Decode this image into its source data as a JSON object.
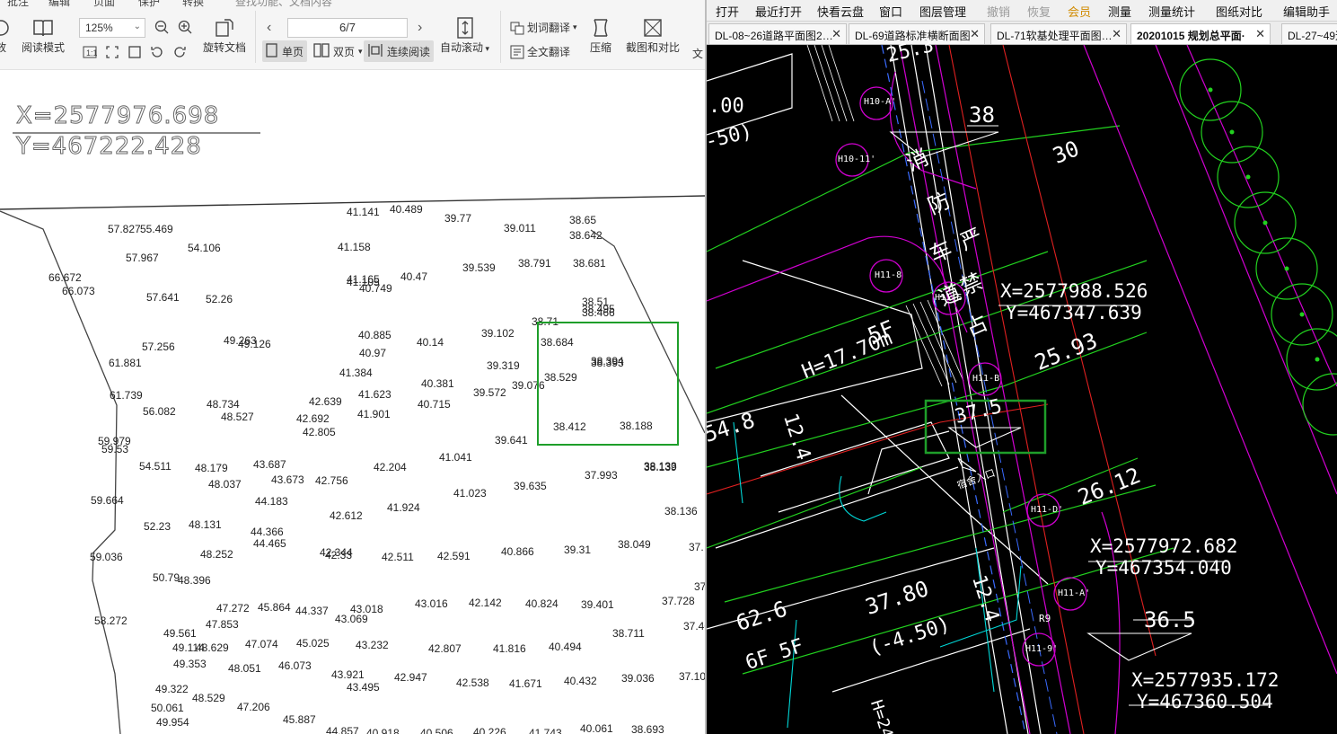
{
  "left_viewer": {
    "menu_fragments": [
      "批注",
      "编辑",
      "页面",
      "保护",
      "转换"
    ],
    "search_placeholder": "查找功能、文档内容",
    "buttons": {
      "zoom_partial": "放",
      "reading_mode": "阅读模式",
      "rotate_doc": "旋转文档",
      "auto_scroll": "自动滚动",
      "compress": "压缩",
      "screenshot_compare": "截图和对比",
      "text_partial": "文"
    },
    "zoom_value": "125%",
    "page_indicator": "6/7",
    "view_modes": {
      "single": "单页",
      "double": "双页",
      "continuous": "连续阅读"
    },
    "translate": {
      "word": "划词翻译",
      "full": "全文翻译"
    },
    "doc": {
      "coord_x": "X=2577976.698",
      "coord_y": "Y=467222.428",
      "elevations": [
        "41.141",
        "40.489",
        "39.77",
        "39.011",
        "38.65",
        "38.642",
        "57.827",
        "55.469",
        "54.106",
        "57.967",
        "41.158",
        "39.539",
        "38.791",
        "38.681",
        "66.672",
        "66.073",
        "41.165",
        "41.105",
        "40.749",
        "40.47",
        "57.641",
        "52.26",
        "38.51",
        "38.495",
        "38.466",
        "38.71",
        "57.256",
        "49.263",
        "49.126",
        "40.885",
        "40.14",
        "39.102",
        "38.684",
        "61.881",
        "40.97",
        "38.394",
        "38.393",
        "39.319",
        "41.384",
        "38.529",
        "40.381",
        "39.076",
        "39.572",
        "61.739",
        "48.734",
        "42.639",
        "41.623",
        "40.715",
        "56.082",
        "48.527",
        "42.692",
        "41.901",
        "42.805",
        "38.412",
        "38.188",
        "39.641",
        "59.979",
        "59.53",
        "41.041",
        "38.139",
        "38.133",
        "54.511",
        "48.179",
        "43.687",
        "43.673",
        "42.756",
        "42.204",
        "37.993",
        "48.037",
        "41.023",
        "39.635",
        "59.664",
        "44.183",
        "41.924",
        "38.136",
        "52.23",
        "48.131",
        "42.612",
        "44.366",
        "44.465",
        "38.049",
        "59.036",
        "48.252",
        "42.344",
        "42.33",
        "42.511",
        "42.591",
        "40.866",
        "39.31",
        "37.",
        "50.79",
        "48.396",
        "37",
        "47.272",
        "45.864",
        "44.337",
        "43.018",
        "43.016",
        "42.142",
        "40.824",
        "39.401",
        "37.728",
        "58.272",
        "47.853",
        "43.069",
        "37.402",
        "49.561",
        "38.711",
        "49.114",
        "48.629",
        "47.074",
        "45.025",
        "43.232",
        "42.807",
        "41.816",
        "40.494",
        "49.353",
        "48.051",
        "46.073",
        "43.921",
        "42.947",
        "42.538",
        "41.671",
        "40.432",
        "39.036",
        "37.10",
        "49.322",
        "43.495",
        "48.529",
        "50.061",
        "47.206",
        "49.954",
        "45.887",
        "44.857",
        "40.918",
        "40.506",
        "40.226",
        "41.743",
        "40.061",
        "38.693"
      ]
    }
  },
  "right_viewer": {
    "menu": [
      "打开",
      "最近打开",
      "快看云盘",
      "窗口",
      "图层管理",
      "撤销",
      "恢复",
      "会员",
      "测量",
      "测量统计",
      "图纸对比",
      "编辑助手"
    ],
    "tabs": [
      "DL-08~26道路平面图2…",
      "DL-69道路标准横断面图",
      "DL-71软基处理平面图…",
      "20201015 规划总平面·",
      "DL-27~49道"
    ],
    "active_tab_index": 3,
    "cad": {
      "dims": [
        "38",
        "30",
        "25.93",
        "26.12",
        "36.5",
        "37.5",
        "37.80",
        "(-4.50)",
        "62.6",
        "54.8",
        "12.4",
        "12.4",
        "H=17.70m",
        "5F",
        "6F 5F",
        "25.3",
        ".00",
        "-50)"
      ],
      "coords": [
        {
          "x": "X=2577988.526",
          "y": "Y=467347.639"
        },
        {
          "x": "X=2577972.682",
          "y": "Y=467354.040"
        },
        {
          "x": "X=2577935.172",
          "y": "Y=467360.504"
        }
      ],
      "hydrants": [
        "H10-A'",
        "H10-11'",
        "H11-8",
        "H11-E",
        "H11-B",
        "H11-D'",
        "H11-A'",
        "H11-9'"
      ],
      "lane_text": [
        "消",
        "防",
        "车",
        "道",
        "严",
        "禁",
        "占",
        "用"
      ],
      "entrance_label": "宿舍入口",
      "misc_label": "R9",
      "bottom_text": "H=24"
    }
  },
  "colors": {
    "highlight_green": "#1e9e2a",
    "cad_bg": "#000000",
    "cad_green": "#22d11f",
    "cad_white": "#ffffff",
    "cad_magenta": "#d100d1",
    "cad_red": "#e02020",
    "cad_cyan": "#00d7d7",
    "cad_blue": "#3a6bff"
  }
}
